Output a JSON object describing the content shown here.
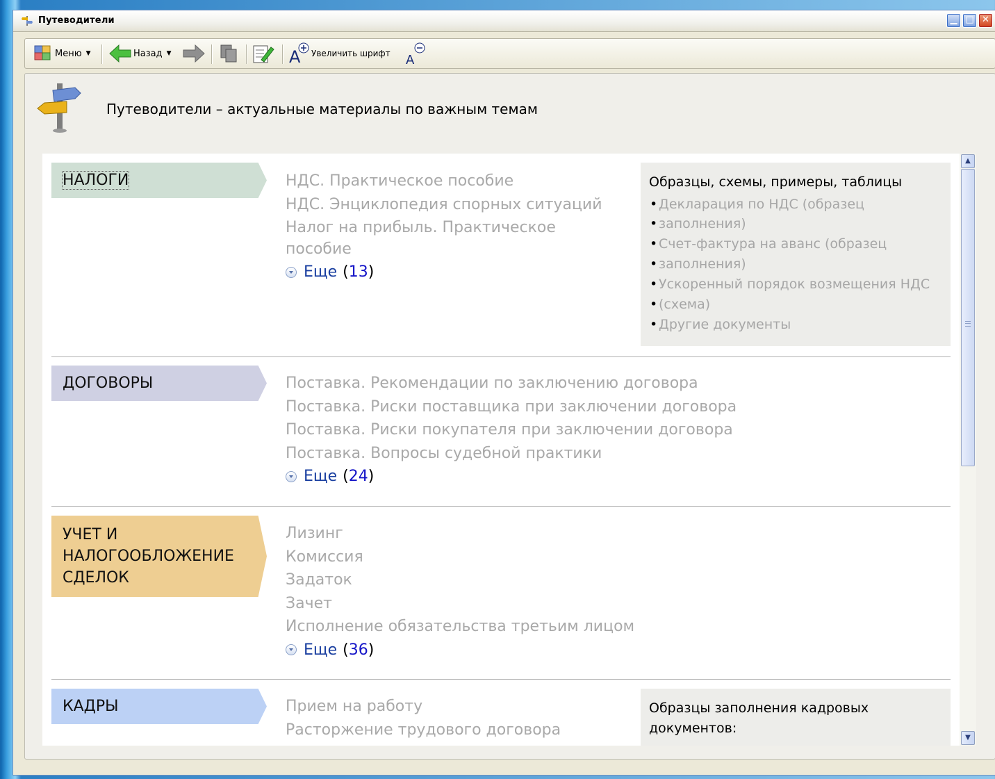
{
  "window": {
    "title": "Путеводители"
  },
  "toolbar": {
    "menu_label": "Меню",
    "back_label": "Назад",
    "font_increase_label": "Увеличить шрифт"
  },
  "page": {
    "title": "Путеводители – актуальные материалы по важным темам"
  },
  "sections": [
    {
      "title": "НАЛОГИ",
      "links": [
        "НДС. Практическое пособие",
        "НДС. Энциклопедия спорных ситуаций",
        "Налог на прибыль. Практическое",
        "пособие"
      ],
      "more_label": "Еще",
      "more_count": "13",
      "side": {
        "heading": "Образцы, схемы, примеры, таблицы",
        "items": [
          "Декларация по НДС (образец",
          "заполнения)",
          "Счет-фактура на аванс (образец",
          "заполнения)",
          "Ускоренный порядок возмещения НДС",
          "(схема)",
          "Другие документы"
        ]
      }
    },
    {
      "title": "ДОГОВОРЫ",
      "links": [
        "Поставка. Рекомендации по заключению договора",
        "Поставка. Риски поставщика при заключении договора",
        "Поставка. Риски покупателя при заключении договора",
        "Поставка. Вопросы судебной практики"
      ],
      "more_label": "Еще",
      "more_count": "24"
    },
    {
      "title_lines": [
        "УЧЕТ И",
        "НАЛОГООБЛОЖЕНИЕ",
        "СДЕЛОК"
      ],
      "links": [
        "Лизинг",
        "Комиссия",
        "Задаток",
        "Зачет",
        "Исполнение обязательства третьим лицом"
      ],
      "more_label": "Еще",
      "more_count": "36"
    },
    {
      "title": "КАДРЫ",
      "links": [
        "Прием на работу",
        "Расторжение трудового договора"
      ],
      "side": {
        "heading_lines": [
          "Образцы заполнения кадровых",
          "документов:"
        ]
      }
    }
  ]
}
